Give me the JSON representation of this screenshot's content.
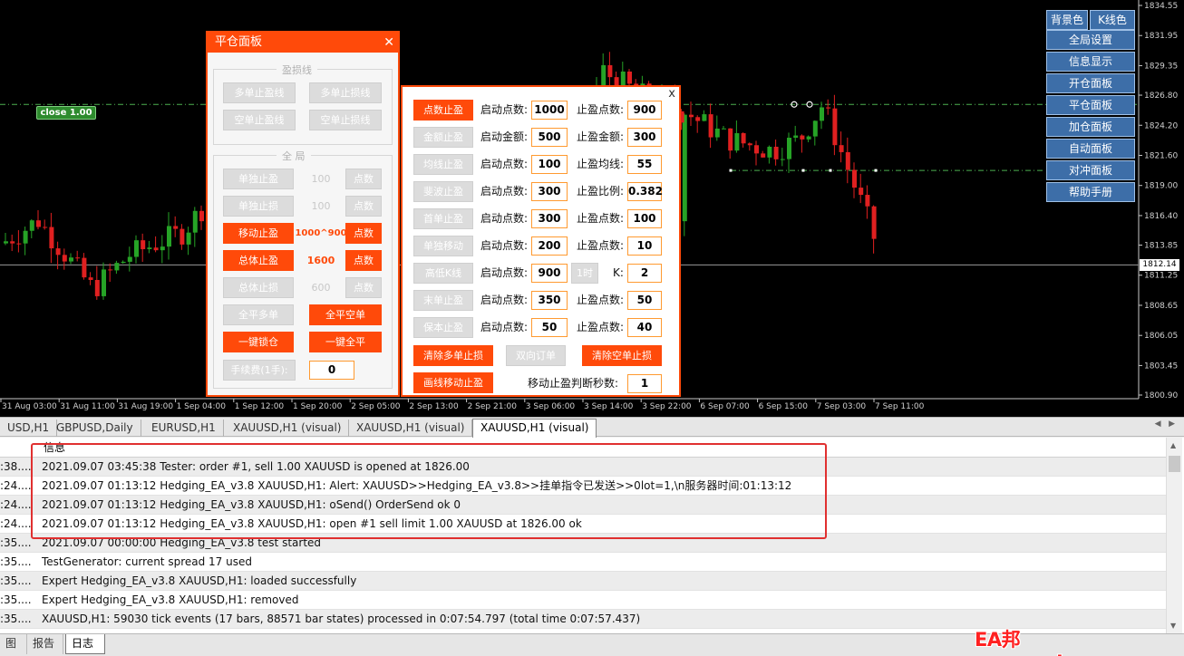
{
  "colors": {
    "up": "#26a326",
    "down": "#e02020",
    "accent": "#ff4a0a",
    "panel_button": "#3d6ea8"
  },
  "chart": {
    "close_badge": "close 1.00",
    "current_price": "1812.14",
    "y_ticks": [
      "1834.55",
      "1831.95",
      "1829.35",
      "1826.80",
      "1824.20",
      "1821.60",
      "1819.00",
      "1816.40",
      "1813.85",
      "1811.25",
      "1808.65",
      "1806.05",
      "1803.45",
      "1800.90"
    ],
    "x_ticks": [
      "31 Aug 03:00",
      "31 Aug 11:00",
      "31 Aug 19:00",
      "1 Sep 04:00",
      "1 Sep 12:00",
      "1 Sep 20:00",
      "2 Sep 05:00",
      "2 Sep 13:00",
      "2 Sep 21:00",
      "3 Sep 06:00",
      "3 Sep 14:00",
      "3 Sep 22:00",
      "6 Sep 07:00",
      "6 Sep 15:00",
      "7 Sep 03:00",
      "7 Sep 11:00"
    ]
  },
  "right_panel": {
    "bg_color": "背景色",
    "k_color": "K线色",
    "items": [
      "全局设置",
      "信息显示",
      "开仓面板",
      "平仓面板",
      "加仓面板",
      "自动面板",
      "对冲面板",
      "帮助手册"
    ]
  },
  "panel1": {
    "title": "平仓面板",
    "close": "✕",
    "group1_title": "盈损线",
    "g1_buttons": [
      "多单止盈线",
      "多单止损线",
      "空单止盈线",
      "空单止损线"
    ],
    "group2_title": "全 局",
    "rows": [
      {
        "label": "单独止盈",
        "value": "100",
        "unit": "点数"
      },
      {
        "label": "单独止损",
        "value": "100",
        "unit": "点数"
      },
      {
        "label": "移动止盈",
        "value": "1000^900",
        "unit": "点数"
      },
      {
        "label": "总体止盈",
        "value": "1600",
        "unit": "点数"
      },
      {
        "label": "总体止损",
        "value": "600",
        "unit": "点数"
      }
    ],
    "close_all_buy": "全平多单",
    "close_all_sell": "全平空单",
    "lock": "一键锁仓",
    "close_all": "一键全平",
    "fee_label": "手续费(1手):",
    "fee_value": "0"
  },
  "panel2": {
    "close": "x",
    "rows": [
      {
        "btn": "点数止盈",
        "l1": "启动点数:",
        "v1": "1000",
        "l2": "止盈点数:",
        "v2": "900"
      },
      {
        "btn": "金额止盈",
        "l1": "启动金额:",
        "v1": "500",
        "l2": "止盈金额:",
        "v2": "300"
      },
      {
        "btn": "均线止盈",
        "l1": "启动点数:",
        "v1": "100",
        "l2": "止盈均线:",
        "v2": "55"
      },
      {
        "btn": "斐波止盈",
        "l1": "启动点数:",
        "v1": "300",
        "l2": "止盈比例:",
        "v2": "0.382"
      },
      {
        "btn": "首单止盈",
        "l1": "启动点数:",
        "v1": "300",
        "l2": "止盈点数:",
        "v2": "100"
      },
      {
        "btn": "单独移动",
        "l1": "启动点数:",
        "v1": "200",
        "l2": "止盈点数:",
        "v2": "10"
      },
      {
        "btn": "高低K线",
        "l1": "启动点数:",
        "v1": "900",
        "l2": "K:",
        "v2": "2",
        "mid": "1时"
      },
      {
        "btn": "末单止盈",
        "l1": "启动点数:",
        "v1": "350",
        "l2": "止盈点数:",
        "v2": "50"
      },
      {
        "btn": "保本止盈",
        "l1": "启动点数:",
        "v1": "50",
        "l2": "止盈点数:",
        "v2": "40"
      }
    ],
    "clear_buy_sl": "清除多单止损",
    "two_way": "双向订单",
    "clear_sell_sl": "清除空单止损",
    "draw_trailing": "画线移动止盈",
    "trailing_seconds_label": "移动止盈判断秒数:",
    "trailing_seconds_value": "1"
  },
  "tabs": [
    "USD,H1",
    "GBPUSD,Daily",
    "EURUSD,H1",
    "XAUUSD,H1 (visual)",
    "XAUUSD,H1 (visual)",
    "XAUUSD,H1 (visual)"
  ],
  "log": {
    "header": "信息",
    "rows": [
      {
        "time": ":38....",
        "msg": "2021.09.07 03:45:38  Tester: order #1, sell 1.00 XAUUSD is opened at 1826.00"
      },
      {
        "time": ":24....",
        "msg": "2021.09.07 01:13:12  Hedging_EA_v3.8 XAUUSD,H1: Alert: XAUUSD>>Hedging_EA_v3.8>>挂单指令已发送>>0lot=1,\\n服务器时间:01:13:12"
      },
      {
        "time": ":24....",
        "msg": "2021.09.07 01:13:12  Hedging_EA_v3.8 XAUUSD,H1: oSend() OrderSend ok 0"
      },
      {
        "time": ":24....",
        "msg": "2021.09.07 01:13:12  Hedging_EA_v3.8 XAUUSD,H1: open #1 sell limit 1.00 XAUUSD at 1826.00 ok"
      },
      {
        "time": ":35....",
        "msg": "2021.09.07 00:00:00  Hedging_EA_v3.8 test started"
      },
      {
        "time": ":35....",
        "msg": "TestGenerator: current spread 17 used"
      },
      {
        "time": ":35....",
        "msg": "Expert Hedging_EA_v3.8 XAUUSD,H1: loaded successfully"
      },
      {
        "time": ":35....",
        "msg": "Expert Hedging_EA_v3.8 XAUUSD,H1: removed"
      },
      {
        "time": ":35....",
        "msg": "XAUUSD,H1: 59030 tick events (17 bars, 88571 bar states) processed in 0:07:54.797 (total time 0:07:57.437)"
      }
    ]
  },
  "bottom_tabs": [
    "图",
    "报告",
    "日志"
  ],
  "watermark": "EA邦 www.eabang.com"
}
